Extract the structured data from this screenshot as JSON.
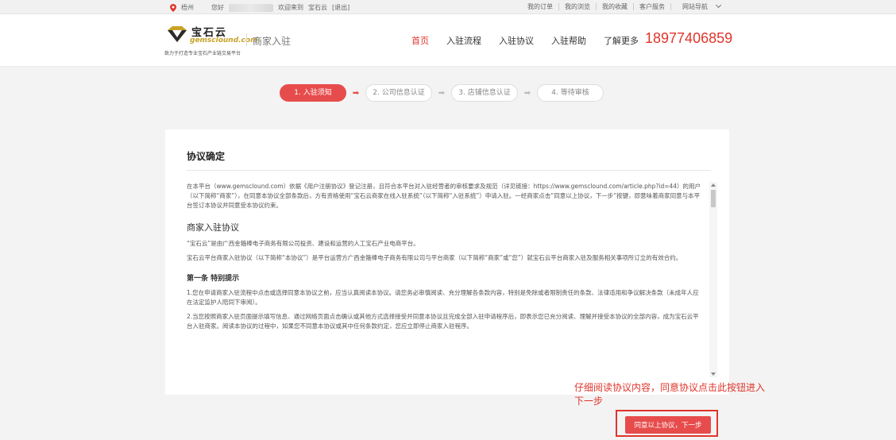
{
  "topbar": {
    "location": "梧州",
    "greeting": "您好",
    "welcome": "欢迎来到",
    "site_name": "宝石云",
    "logout": "[退出]",
    "links": [
      "我的订单",
      "我的浏览",
      "我的收藏",
      "客户服务",
      "网站导航"
    ]
  },
  "header": {
    "logo_name": "宝石云",
    "logo_domain": "gemsclound.com",
    "logo_slogan": "致力于打造专业宝石产业链交易平台",
    "subtitle": "商家入驻",
    "nav": [
      "首页",
      "入驻流程",
      "入驻协议",
      "入驻帮助",
      "了解更多"
    ],
    "phone": "18977406859"
  },
  "steps": [
    "1. 入驻须知",
    "2. 公司信息认证",
    "3. 店铺信息认证",
    "4. 等待审核"
  ],
  "agreement": {
    "title": "协议确定",
    "intro": "在本平台（www.gemsclound.com）依据《用户注册协议》登记注册，且符合本平台对入驻经营者的审核要求及规范（详见链接：https://www.gemsclound.com/article.php?id=44）的用户（以下简称“商家”），在同意本协议全部条款后，方有资格使用“宝石云商家在线入驻系统”（以下简称“入驻系统”）申请入驻。一经商家点击“同意以上协议，下一步”按键，即意味着商家同意与本平台签订本协议并同意受本协议约束。",
    "section_title": "商家入驻协议",
    "para1": "“宝石云”是由广西金箍棒电子商务有限公司投资、建设和运营的人工宝石产业电商平台。",
    "para2": "宝石云平台商家入驻协议（以下简称“本协议”）是平台运营方广西金箍棒电子商务有限公司与平台商家（以下简称“商家”或“您”）就宝石云平台商家入驻及服务相关事项所订立的有效合约。",
    "article1": "第一条 特别提示",
    "item1": "1.您在申请商家入驻流程中点击或选择同意本协议之前，应当认真阅读本协议。请您务必审慎阅读、充分理解各条款内容，特别是免除或者限制责任的条款、法律适用和争议解决条款（未成年人应在法定监护人陪同下审阅）。",
    "item2": "2.当您按照商家入驻页面提示填写信息、通过网络页面点击确认或其他方式选择接受并同意本协议且完成全部入驻申请程序后，即表示您已充分阅读、理解并接受本协议的全部内容，成为宝石云平台入驻商家。阅读本协议的过程中，如果您不同意本协议或其中任何条款约定，您应立即停止商家入驻程序。"
  },
  "annotation": "仔细阅读协议内容，同意协议点击此按钮进入下一步",
  "agree_button": "同意以上协议，下一步",
  "colors": {
    "accent": "#e74c4c",
    "brand_gold": "#c9a227"
  }
}
